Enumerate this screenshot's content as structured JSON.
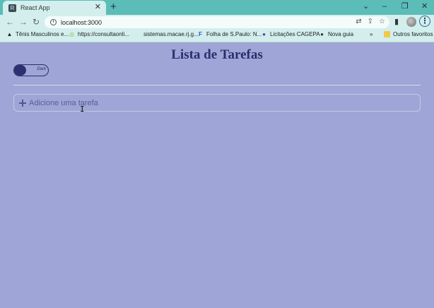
{
  "browser": {
    "tab_title": "React App",
    "tab_favicon": "R",
    "tab_close": "✕",
    "new_tab": "+",
    "window_controls": {
      "dropdown": "⌄",
      "minimize": "–",
      "restore": "❐",
      "close": "✕"
    },
    "nav": {
      "back": "←",
      "forward": "→",
      "reload": "↻"
    },
    "url": "localhost:3000",
    "omnibox_icons": {
      "translate": "⇄",
      "share": "⇪",
      "bookmark": "☆"
    },
    "sidebar_toggle": "▮",
    "menu": "⋮"
  },
  "bookmarks": {
    "items": [
      {
        "label": "Tênis Masculinos e...",
        "icon": "▲"
      },
      {
        "label": "https://consultaonli...",
        "icon": "◎"
      },
      {
        "label": "sistemas.macae.rj.g...",
        "icon": ""
      },
      {
        "label": "Folha de S.Paulo: N...",
        "icon": "F"
      },
      {
        "label": "Licitações CAGEPA",
        "icon": "●"
      },
      {
        "label": "Nova guia",
        "icon": "●"
      }
    ],
    "overflow": "»",
    "other_label": "Outros favoritos"
  },
  "app": {
    "title": "Lista de Tarefas",
    "theme_toggle_label": "Dark",
    "input_placeholder": "Adicione uma tarefa",
    "input_value": ""
  },
  "colors": {
    "background": "#9fa5d6",
    "title": "#2a2f6c",
    "browser_frame": "#5bbcb8",
    "toolbar": "#d3eeed"
  }
}
